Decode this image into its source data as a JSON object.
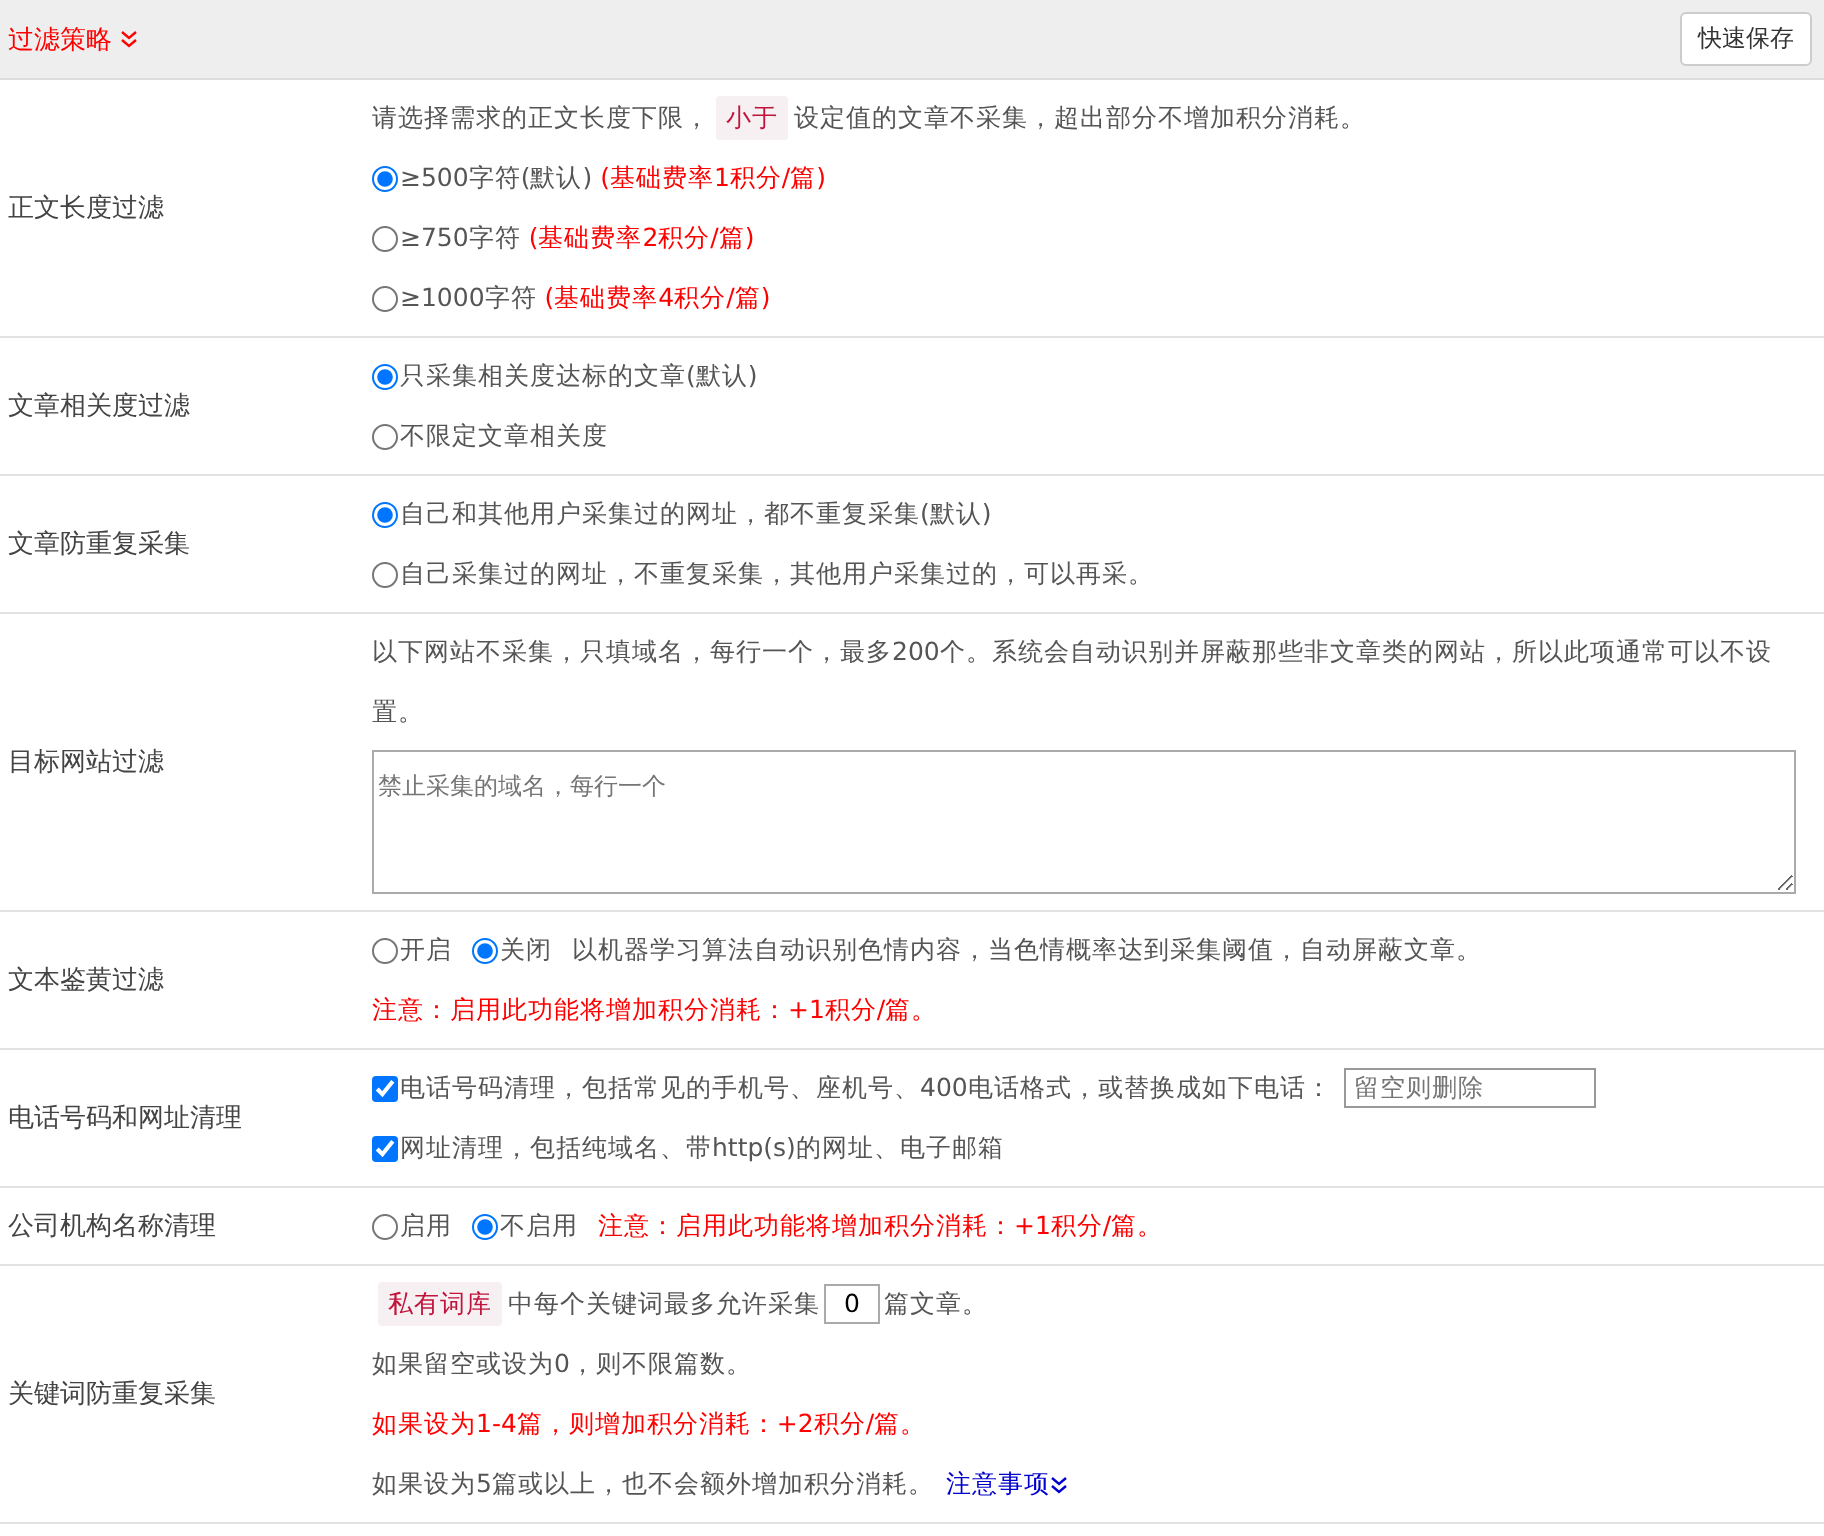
{
  "header": {
    "title": "过滤策略",
    "save_button": "快速保存"
  },
  "rows": [
    {
      "label": "正文长度过滤",
      "lines": [
        {
          "kind": "mixed",
          "segments": [
            {
              "kind": "text",
              "text": "请选择需求的正文长度下限，"
            },
            {
              "kind": "tag",
              "text": "小于"
            },
            {
              "kind": "text",
              "text": "设定值的文章不采集，超出部分不增加积分消耗。"
            }
          ]
        },
        {
          "kind": "radio",
          "label": "≥500字符(默认)",
          "note": "(基础费率1积分/篇)",
          "selected": true
        },
        {
          "kind": "radio",
          "label": "≥750字符",
          "note": "(基础费率2积分/篇)",
          "selected": false
        },
        {
          "kind": "radio",
          "label": "≥1000字符",
          "note": "(基础费率4积分/篇)",
          "selected": false
        }
      ]
    },
    {
      "label": "文章相关度过滤",
      "lines": [
        {
          "kind": "radio",
          "label": "只采集相关度达标的文章(默认)",
          "selected": true
        },
        {
          "kind": "radio",
          "label": "不限定文章相关度",
          "selected": false
        }
      ]
    },
    {
      "label": "文章防重复采集",
      "lines": [
        {
          "kind": "radio",
          "label": "自己和其他用户采集过的网址，都不重复采集(默认)",
          "selected": true
        },
        {
          "kind": "radio",
          "label": "自己采集过的网址，不重复采集，其他用户采集过的，可以再采。",
          "selected": false
        }
      ]
    },
    {
      "label": "目标网站过滤",
      "lines": [
        {
          "kind": "text",
          "text": "以下网站不采集，只填域名，每行一个，最多200个。系统会自动识别并屏蔽那些非文章类的网站，所以此项通常可以不设置。"
        },
        {
          "kind": "textarea",
          "placeholder": "禁止采集的域名，每行一个"
        }
      ]
    },
    {
      "label": "文本鉴黄过滤",
      "lines": [
        {
          "kind": "radios",
          "options": [
            {
              "label": "开启",
              "selected": false
            },
            {
              "label": "关闭",
              "selected": true
            }
          ],
          "desc": "以机器学习算法自动识别色情内容，当色情概率达到采集阈值，自动屏蔽文章。"
        },
        {
          "kind": "note",
          "text": "注意：启用此功能将增加积分消耗：+1积分/篇。"
        }
      ]
    },
    {
      "label": "电话号码和网址清理",
      "lines": [
        {
          "kind": "checkbox",
          "label": "电话号码清理，包括常见的手机号、座机号、400电话格式，或替换成如下电话：",
          "checked": true,
          "placeholder": "留空则删除"
        },
        {
          "kind": "checkbox",
          "label": "网址清理，包括纯域名、带http(s)的网址、电子邮箱",
          "checked": true
        }
      ]
    },
    {
      "label": "公司机构名称清理",
      "lines": [
        {
          "kind": "radios",
          "options": [
            {
              "label": "启用",
              "selected": false
            },
            {
              "label": "不启用",
              "selected": true
            }
          ],
          "note": "注意：启用此功能将增加积分消耗：+1积分/篇。"
        }
      ]
    },
    {
      "label": "关键词防重复采集",
      "lines": [
        {
          "kind": "mixed",
          "segments": [
            {
              "kind": "tag",
              "text": "私有词库"
            },
            {
              "kind": "text",
              "text": "中每个关键词最多允许采集"
            },
            {
              "kind": "input",
              "value": "0"
            },
            {
              "kind": "text",
              "text": "篇文章。"
            }
          ]
        },
        {
          "kind": "text",
          "text": "如果留空或设为0，则不限篇数。"
        },
        {
          "kind": "note",
          "text": "如果设为1-4篇，则增加积分消耗：+2积分/篇。"
        },
        {
          "kind": "mixed",
          "segments": [
            {
              "kind": "text",
              "text": "如果设为5篇或以上，也不会额外增加积分消耗。"
            },
            {
              "kind": "link",
              "text": "注意事项"
            }
          ]
        }
      ]
    }
  ]
}
